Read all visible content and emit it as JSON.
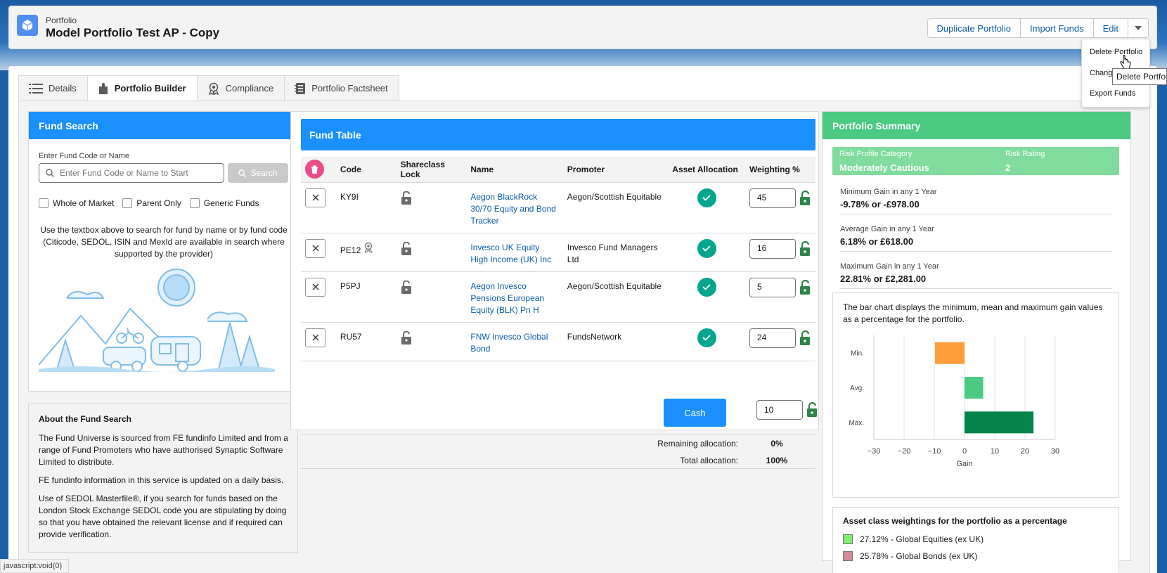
{
  "header": {
    "eyebrow": "Portfolio",
    "title": "Model Portfolio Test AP - Copy",
    "buttons": {
      "duplicate": "Duplicate Portfolio",
      "import": "Import Funds",
      "edit": "Edit"
    }
  },
  "dropdown": {
    "items": [
      "Delete Portfolio",
      "Chang",
      "Export Funds"
    ],
    "tooltip": "Delete Portfolio"
  },
  "tabs": [
    {
      "label": "Details",
      "icon": "list-icon"
    },
    {
      "label": "Portfolio Builder",
      "icon": "puzzle-icon"
    },
    {
      "label": "Compliance",
      "icon": "award-icon"
    },
    {
      "label": "Portfolio Factsheet",
      "icon": "notebook-icon"
    }
  ],
  "fund_search": {
    "title": "Fund Search",
    "input_label": "Enter Fund Code or Name",
    "input_placeholder": "Enter Fund Code or Name to Start",
    "search_button": "Search",
    "checks": [
      "Whole of Market",
      "Parent Only",
      "Generic Funds"
    ],
    "help": "Use the textbox above to search for fund by name or by fund code (Citicode, SEDOL, ISIN and MexId are available in search where supported by the provider)"
  },
  "about": {
    "title": "About the Fund Search",
    "paragraphs": [
      "The Fund Universe is sourced from FE fundinfo Limited and from a range of Fund Promoters who have authorised Synaptic Software Limited to distribute.",
      "FE fundinfo information in this service is updated on a daily basis.",
      "Use of SEDOL Masterfile®, if you search for funds based on the London Stock Exchange SEDOL code you are stipulating by doing so that you have obtained the relevant license and if required can provide verification."
    ]
  },
  "fund_table": {
    "title": "Fund Table",
    "columns": [
      "Code",
      "Shareclass Lock",
      "Name",
      "Promoter",
      "Asset Allocation",
      "Weighting %"
    ],
    "rows": [
      {
        "code": "KY9I",
        "name": "Aegon BlackRock 30/70 Equity and Bond Tracker",
        "promoter": "Aegon/Scottish Equitable",
        "weight": "45"
      },
      {
        "code": "PE12",
        "name": "Invesco UK Equity High Income (UK) Inc",
        "promoter": "Invesco Fund Managers Ltd",
        "weight": "16"
      },
      {
        "code": "P5PJ",
        "name": "Aegon Invesco Pensions European Equity (BLK) Pn H",
        "promoter": "Aegon/Scottish Equitable",
        "weight": "5"
      },
      {
        "code": "RU57",
        "name": "FNW Invesco Global Bond",
        "promoter": "FundsNetwork",
        "weight": "24"
      }
    ],
    "cash_label": "Cash",
    "cash_weight": "10",
    "remaining_label": "Remaining allocation:",
    "remaining_value": "0%",
    "total_label": "Total allocation:",
    "total_value": "100%"
  },
  "summary": {
    "title": "Portfolio Summary",
    "risk_category_label": "Risk Profile Category",
    "risk_category_value": "Moderately Cautious",
    "risk_rating_label": "Risk Rating",
    "risk_rating_value": "2",
    "stats": [
      {
        "label": "Minimum Gain in any 1 Year",
        "value": "-9.78% or -£978.00"
      },
      {
        "label": "Average Gain in any 1 Year",
        "value": "6.18% or £618.00"
      },
      {
        "label": "Maximum Gain in any 1 Year",
        "value": "22.81% or £2,281.00"
      }
    ],
    "chart_desc": "The bar chart displays the minimum, mean and maximum gain values as a percentage for the portfolio.",
    "asset_title": "Asset class weightings for the portfolio as a percentage",
    "assets": [
      {
        "label": "27.12% - Global Equities (ex UK)",
        "color": "#7cf06a"
      },
      {
        "label": "25.78% - Global Bonds (ex UK)",
        "color": "#d48a98"
      }
    ]
  },
  "chart_data": {
    "type": "bar",
    "orientation": "horizontal",
    "categories": [
      "Min.",
      "Avg.",
      "Max."
    ],
    "values": [
      -9.78,
      6.18,
      22.81
    ],
    "colors": [
      "#ff9d3b",
      "#4bca81",
      "#04844b"
    ],
    "xlabel": "Gain",
    "xlim": [
      -30,
      30
    ],
    "xticks": [
      "−30",
      "−20",
      "−10",
      "0",
      "10",
      "20",
      "30"
    ]
  },
  "statusbar": "javascript:void(0)"
}
